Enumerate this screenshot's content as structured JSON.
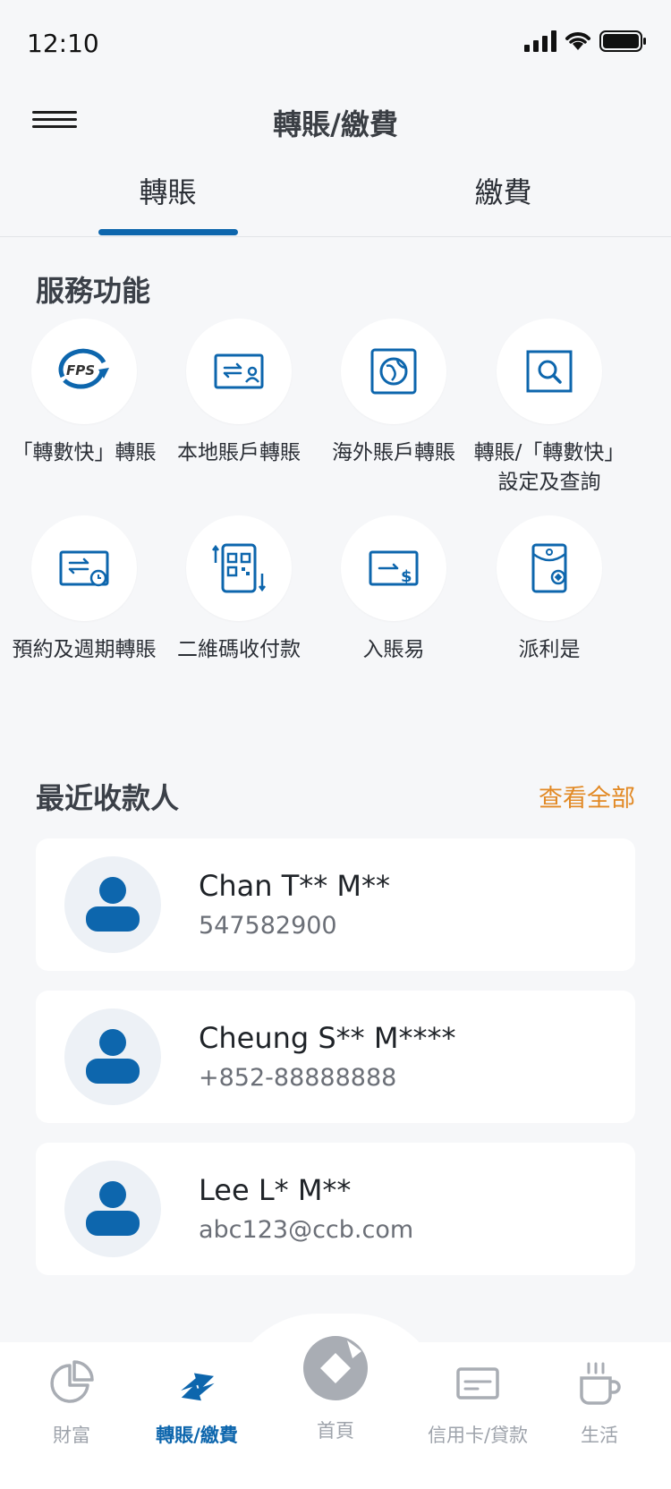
{
  "status_bar": {
    "time": "12:10"
  },
  "header": {
    "title": "轉賬/繳費"
  },
  "tabs": [
    {
      "label": "轉賬",
      "active": true
    },
    {
      "label": "繳費",
      "active": false
    }
  ],
  "services": {
    "title": "服務功能",
    "items": [
      {
        "label": "「轉數快」轉賬",
        "icon": "fps-icon"
      },
      {
        "label": "本地賬戶轉賬",
        "icon": "local-transfer-icon"
      },
      {
        "label": "海外賬戶轉賬",
        "icon": "overseas-transfer-icon"
      },
      {
        "label": "轉賬/「轉數快」設定及查詢",
        "icon": "search-settings-icon"
      },
      {
        "label": "預約及週期轉賬",
        "icon": "scheduled-transfer-icon"
      },
      {
        "label": "二維碼收付款",
        "icon": "qr-code-icon"
      },
      {
        "label": "入賬易",
        "icon": "deposit-icon"
      },
      {
        "label": "派利是",
        "icon": "red-packet-icon"
      }
    ]
  },
  "recent": {
    "title": "最近收款人",
    "view_all": "查看全部",
    "payees": [
      {
        "name": "Chan T** M**",
        "account": "547582900"
      },
      {
        "name": "Cheung S** M****",
        "account": "+852-88888888"
      },
      {
        "name": "Lee L* M**",
        "account": "abc123@ccb.com"
      }
    ]
  },
  "bottom_nav": {
    "items": [
      {
        "label": "財富",
        "icon": "pie-chart-icon",
        "active": false
      },
      {
        "label": "轉賬/繳費",
        "icon": "transfer-arrows-icon",
        "active": true
      },
      {
        "label": "首頁",
        "icon": "home-logo-icon",
        "active": false
      },
      {
        "label": "信用卡/貸款",
        "icon": "credit-card-icon",
        "active": false
      },
      {
        "label": "生活",
        "icon": "coffee-cup-icon",
        "active": false
      }
    ]
  },
  "colors": {
    "primary": "#0d66ad",
    "accent_orange": "#e28a26",
    "background": "#f6f7f9"
  }
}
